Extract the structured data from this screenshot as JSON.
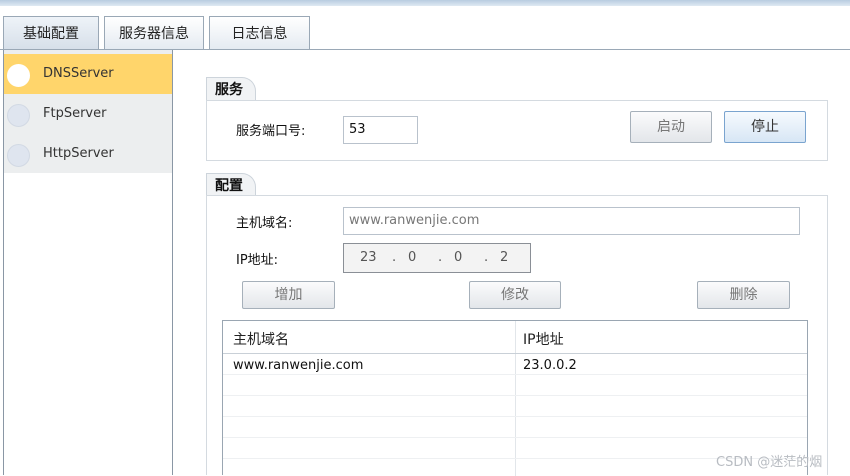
{
  "tabs": [
    {
      "label": "基础配置",
      "active": true
    },
    {
      "label": "服务器信息",
      "active": false
    },
    {
      "label": "日志信息",
      "active": false
    }
  ],
  "servers": [
    {
      "label": "DNSServer",
      "selected": true
    },
    {
      "label": "FtpServer",
      "selected": false
    },
    {
      "label": "HttpServer",
      "selected": false
    }
  ],
  "service": {
    "title": "服务",
    "port_label": "服务端口号:",
    "port_value": "53",
    "start_label": "启动",
    "stop_label": "停止"
  },
  "config": {
    "title": "配置",
    "host_label": "主机域名:",
    "host_value": "www.ranwenjie.com",
    "ip_label": "IP地址:",
    "ip_octets": [
      "23",
      "0",
      "0",
      "2"
    ],
    "add_label": "增加",
    "edit_label": "修改",
    "delete_label": "删除"
  },
  "table": {
    "headers": [
      "主机域名",
      "IP地址"
    ],
    "rows": [
      [
        "www.ranwenjie.com",
        "23.0.0.2"
      ]
    ]
  },
  "watermark": "CSDN @迷茫的烟",
  "colors": {
    "selected_bg": "#ffd56b",
    "primary_button_border": "#7aa4cf"
  }
}
